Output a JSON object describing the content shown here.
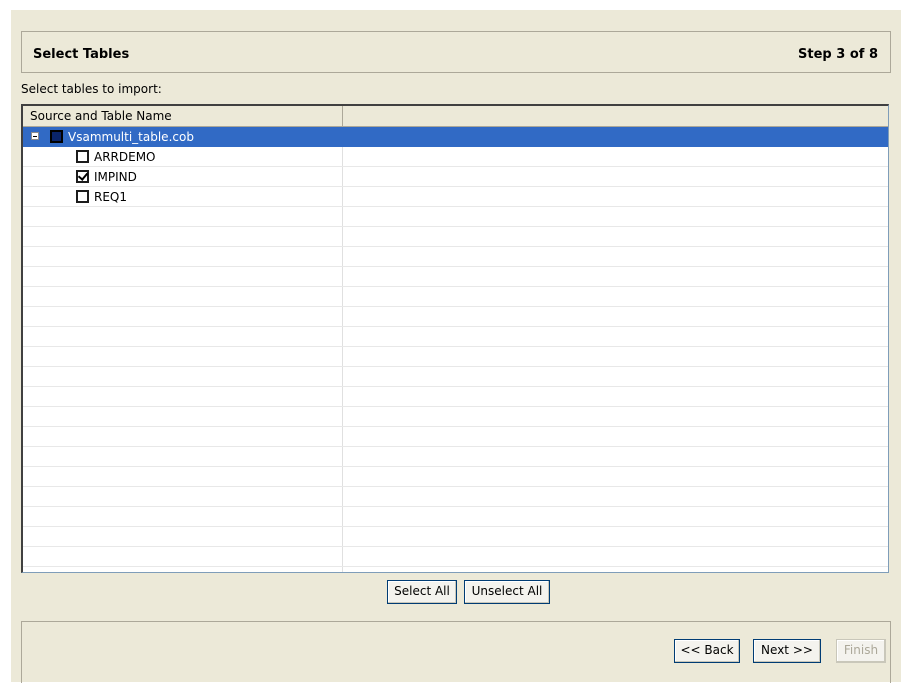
{
  "header": {
    "title": "Select Tables",
    "step": "Step 3 of 8"
  },
  "instructions": "Select tables to import:",
  "table": {
    "column_header": "Source and Table Name",
    "source": {
      "name": "Vsammulti_table.cob",
      "state": "partial"
    },
    "items": [
      {
        "name": "ARRDEMO",
        "checked": false
      },
      {
        "name": "IMPIND",
        "checked": true
      },
      {
        "name": "REQ1",
        "checked": false
      }
    ]
  },
  "buttons": {
    "select_all": "Select All",
    "unselect_all": "Unselect All",
    "back": "<< Back",
    "next": "Next >>",
    "finish": "Finish"
  }
}
